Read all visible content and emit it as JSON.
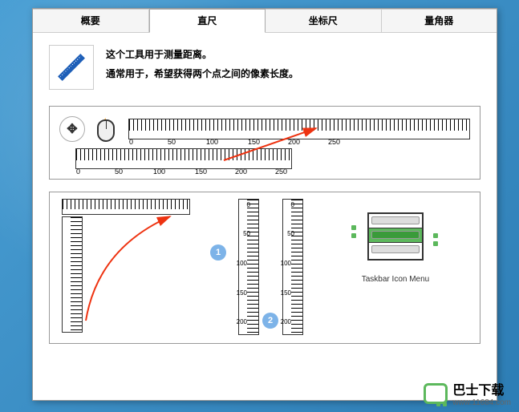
{
  "tabs": [
    "概要",
    "直尺",
    "坐标尺",
    "量角器"
  ],
  "activeTab": 1,
  "intro": {
    "line1": "这个工具用于测量距离。",
    "line2": "通常用于，希望获得两个点之间的像素长度。"
  },
  "ruler1_labels": [
    "0",
    "50",
    "100",
    "150",
    "200",
    "250"
  ],
  "ruler2_labels": [
    "0",
    "50",
    "100",
    "150",
    "200",
    "250"
  ],
  "badges": {
    "b1": "1",
    "b2": "2"
  },
  "taskbar_label": "Taskbar Icon Menu",
  "watermark": {
    "name": "巴士下载",
    "url": "www.11684.com"
  }
}
